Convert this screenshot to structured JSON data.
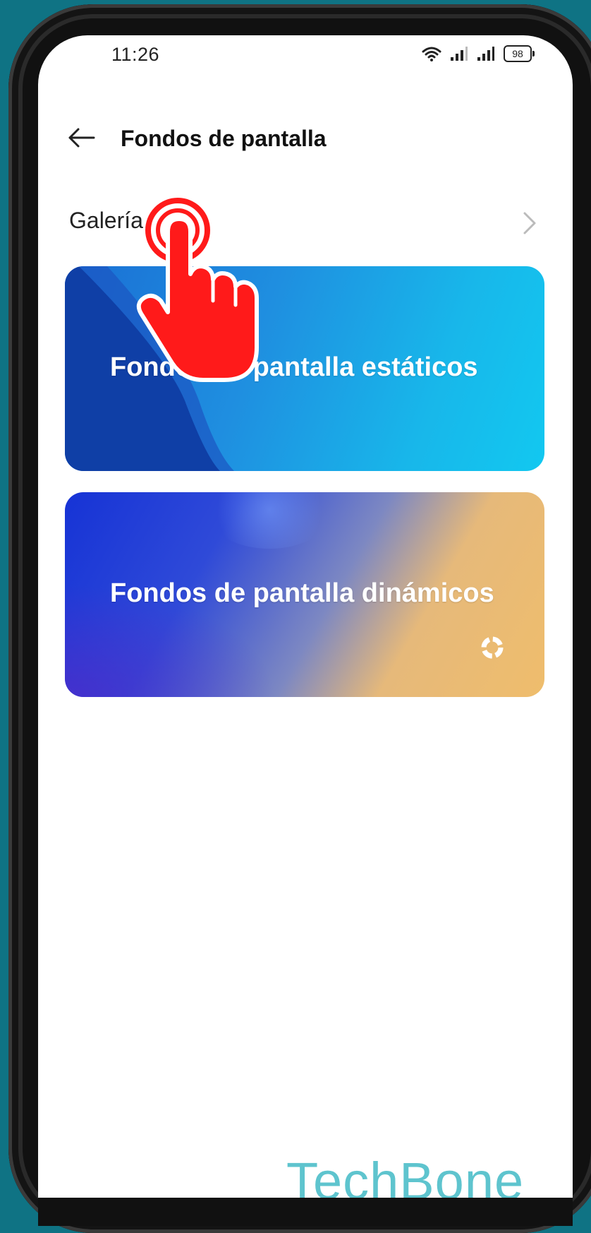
{
  "status_bar": {
    "time": "11:26",
    "battery": "98"
  },
  "header": {
    "title": "Fondos de pantalla"
  },
  "gallery": {
    "label": "Galería"
  },
  "cards": {
    "static_label": "Fondos de pantalla estáticos",
    "dynamic_label": "Fondos de pantalla dinámicos"
  },
  "watermark": "TechBone",
  "colors": {
    "background": "#0f7384",
    "tap_marker": "#ff1a1a",
    "watermark": "#5ec4ce"
  },
  "icons": {
    "back": "arrow-left-icon",
    "chevron": "chevron-right-icon",
    "wifi": "wifi-icon",
    "signal": "signal-icon",
    "battery": "battery-icon",
    "dynamic": "loading-ring-icon",
    "tap": "tap-hand-icon"
  }
}
